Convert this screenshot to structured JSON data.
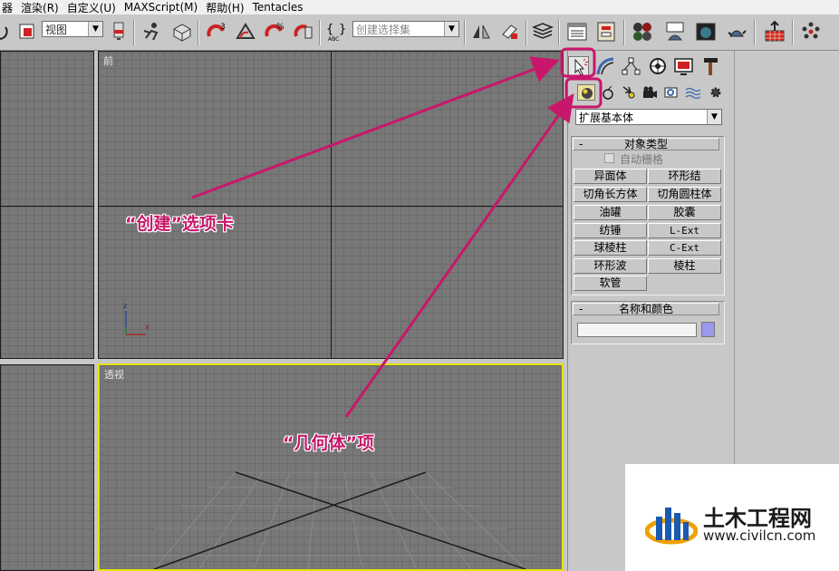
{
  "menu": [
    "器",
    "渲染(R)",
    "自定义(U)",
    "MAXScript(M)",
    "帮助(H)",
    "Tentacles"
  ],
  "toolbar": {
    "view_select": "视图",
    "selection_set_placeholder": "创建选择集"
  },
  "viewports": {
    "front_label": "前",
    "perspective_label": "透视",
    "axis_z": "z",
    "axis_x": "x"
  },
  "panel": {
    "dropdown_value": "扩展基本体",
    "object_type": {
      "title": "对象类型",
      "autogrid_label": "自动栅格",
      "buttons": [
        "异面体",
        "环形结",
        "切角长方体",
        "切角圆柱体",
        "油罐",
        "胶囊",
        "纺锤",
        "L-Ext",
        "球棱柱",
        "C-Ext",
        "环形波",
        "棱柱",
        "软管"
      ]
    },
    "name_color": {
      "title": "名称和颜色",
      "name_value": "",
      "swatch_color": "#9999ee"
    },
    "rollout_toggle": "-"
  },
  "annotations": {
    "create_tab": "“创建”选项卡",
    "geometry_item": "“几何体”项",
    "color": "#c8176b"
  },
  "watermark": {
    "brand": "土木工程网",
    "url": "www.civilcn.com"
  }
}
